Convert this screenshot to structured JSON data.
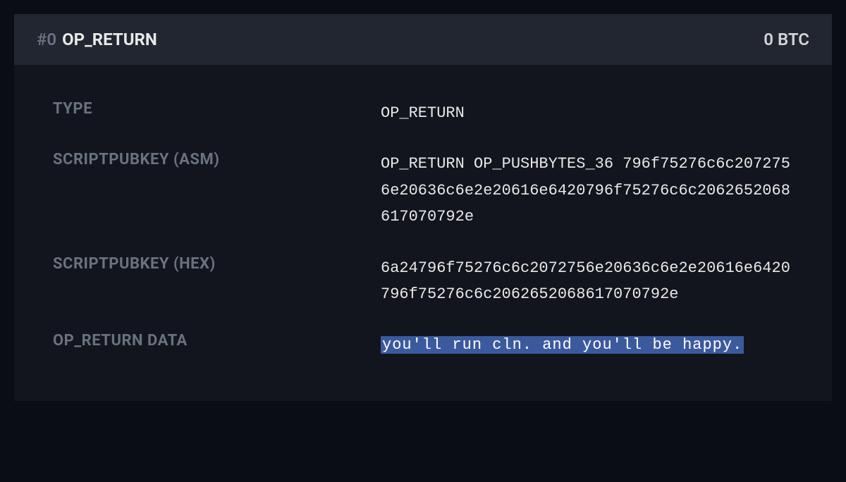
{
  "header": {
    "index": "#0",
    "title": "OP_RETURN",
    "amount": "0 BTC"
  },
  "details": {
    "type": {
      "label": "TYPE",
      "value": "OP_RETURN"
    },
    "asm": {
      "label": "SCRIPTPUBKEY (ASM)",
      "value": "OP_RETURN OP_PUSHBYTES_36 796f75276c6c2072756e20636c6e2e20616e6420796f75276c6c2062652068617070792e"
    },
    "hex": {
      "label": "SCRIPTPUBKEY (HEX)",
      "value": "6a24796f75276c6c2072756e20636c6e2e20616e6420796f75276c6c2062652068617070792e"
    },
    "opreturn": {
      "label": "OP_RETURN DATA",
      "value": "you'll run cln. and you'll be happy."
    }
  }
}
